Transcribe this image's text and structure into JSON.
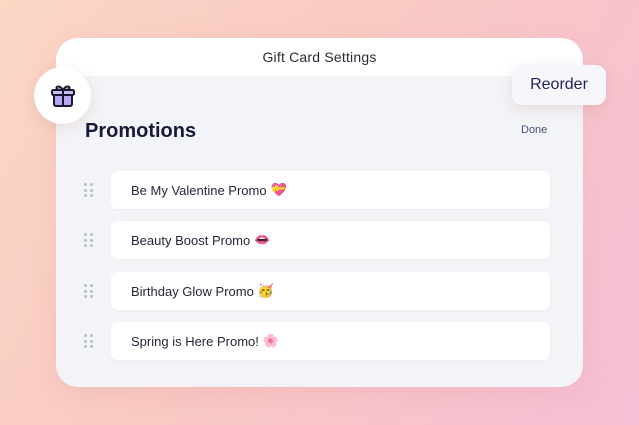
{
  "dialog": {
    "title": "Gift Card Settings"
  },
  "section": {
    "title": "Promotions",
    "done_label": "Done"
  },
  "promotions": [
    {
      "label": "Be My Valentine Promo",
      "emoji": "💝"
    },
    {
      "label": "Beauty Boost Promo",
      "emoji": "👄"
    },
    {
      "label": "Birthday Glow Promo",
      "emoji": "🥳"
    },
    {
      "label": "Spring is Here Promo!",
      "emoji": "🌸"
    }
  ],
  "reorder_button": {
    "label": "Reorder"
  },
  "icons": {
    "gift": "gift-icon",
    "drag": "drag-handle-icon"
  },
  "colors": {
    "accent": "#1e2358",
    "gift_fill": "#b9a6f2",
    "gift_stroke": "#16182f"
  }
}
